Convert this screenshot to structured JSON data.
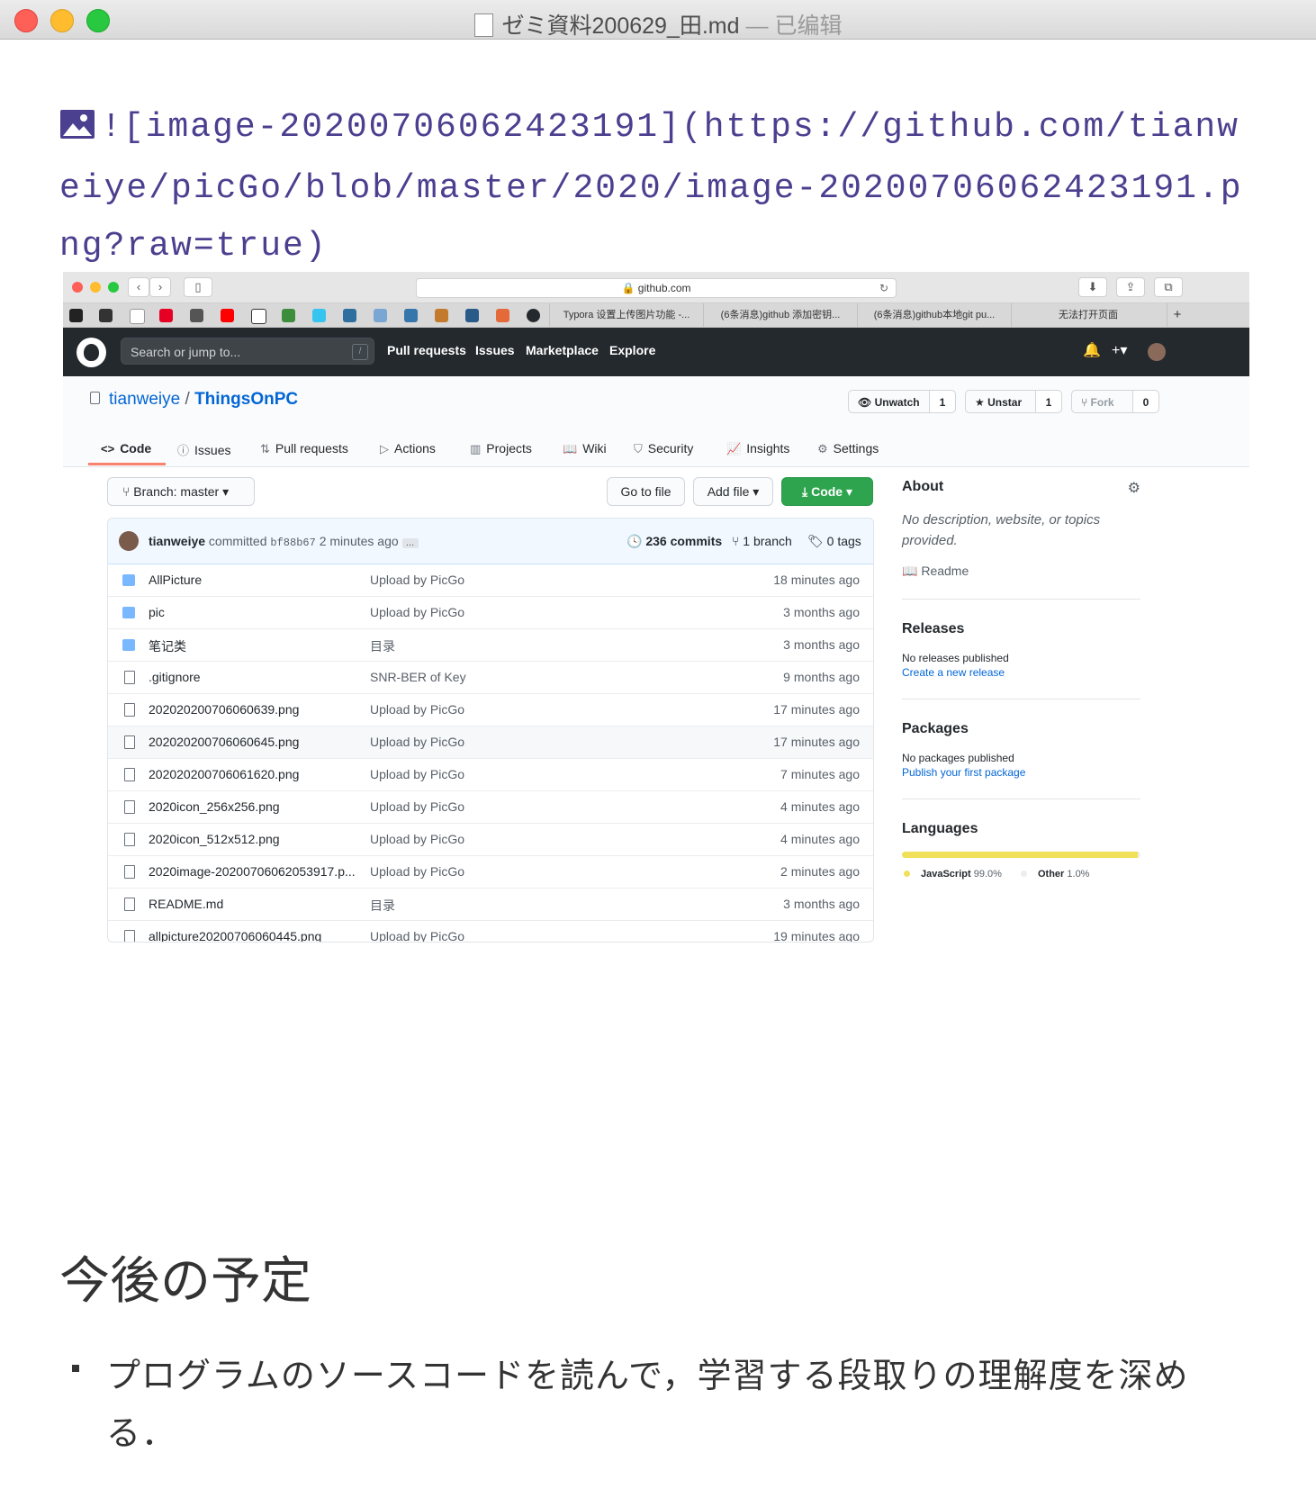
{
  "window": {
    "title": "ゼミ資料200629_田.md",
    "edited_suffix": " — 已编辑"
  },
  "markdown": {
    "image_source": "![image-20200706062423191](https://github.com/tianweiye/picGo/blob/master/2020/image-20200706062423191.png?raw=true)",
    "heading": "今後の予定",
    "bullet_1": "プログラムのソースコードを読んで，学習する段取りの理解度を深める．"
  },
  "browser": {
    "url": "github.com",
    "tabs": [
      "Typora 设置上传图片功能 -...",
      "(6条消息)github 添加密钥...",
      "(6条消息)github本地git pu...",
      "无法打开页面"
    ]
  },
  "github": {
    "search_placeholder": "Search or jump to...",
    "slash_hint": "/",
    "nav": [
      "Pull requests",
      "Issues",
      "Marketplace",
      "Explore"
    ],
    "repo_owner": "tianweiye",
    "repo_separator": " / ",
    "repo_name": "ThingsOnPC",
    "unwatch_label": "Unwatch",
    "unwatch_count": "1",
    "unstar_label": "Unstar",
    "unstar_count": "1",
    "fork_label": "Fork",
    "fork_count": "0",
    "tabs": [
      "Code",
      "Issues",
      "Pull requests",
      "Actions",
      "Projects",
      "Wiki",
      "Security",
      "Insights",
      "Settings"
    ],
    "branch_label": "Branch: master",
    "go_to_file": "Go to file",
    "add_file": "Add file",
    "code_button": "Code",
    "commit": {
      "author": "tianweiye",
      "action": "committed",
      "hash": "bf88b67",
      "time": "2 minutes ago",
      "ellipsis": "…",
      "commits": "236 commits",
      "branches": "1 branch",
      "tags": "0 tags"
    },
    "files": [
      {
        "name": "AllPicture",
        "msg": "Upload by PicGo",
        "age": "18 minutes ago"
      },
      {
        "name": "pic",
        "msg": "Upload by PicGo",
        "age": "3 months ago"
      },
      {
        "name": "笔记类",
        "msg": "目录",
        "age": "3 months ago"
      },
      {
        "name": ".gitignore",
        "msg": "SNR-BER of Key",
        "age": "9 months ago"
      },
      {
        "name": "202020200706060639.png",
        "msg": "Upload by PicGo",
        "age": "17 minutes ago"
      },
      {
        "name": "202020200706060645.png",
        "msg": "Upload by PicGo",
        "age": "17 minutes ago"
      },
      {
        "name": "202020200706061620.png",
        "msg": "Upload by PicGo",
        "age": "7 minutes ago"
      },
      {
        "name": "2020icon_256x256.png",
        "msg": "Upload by PicGo",
        "age": "4 minutes ago"
      },
      {
        "name": "2020icon_512x512.png",
        "msg": "Upload by PicGo",
        "age": "4 minutes ago"
      },
      {
        "name": "2020image-20200706062053917.p...",
        "msg": "Upload by PicGo",
        "age": "2 minutes ago"
      },
      {
        "name": "README.md",
        "msg": "目录",
        "age": "3 months ago"
      },
      {
        "name": "allpicture20200706060445.png",
        "msg": "Upload by PicGo",
        "age": "19 minutes ago"
      }
    ],
    "about": {
      "heading": "About",
      "description": "No description, website, or topics provided.",
      "readme": "Readme"
    },
    "releases": {
      "heading": "Releases",
      "text": "No releases published",
      "link": "Create a new release"
    },
    "packages": {
      "heading": "Packages",
      "text": "No packages published",
      "link": "Publish your first package"
    },
    "languages": {
      "heading": "Languages",
      "items": [
        {
          "name": "JavaScript",
          "percent": "99.0%",
          "color": "#f1e05a",
          "fraction": 0.99
        },
        {
          "name": "Other",
          "percent": "1.0%",
          "color": "#ededed",
          "fraction": 0.01
        }
      ]
    }
  },
  "colors": {
    "markdown_source": "#4b3f8f",
    "github_header": "#24292e",
    "link": "#0366d6",
    "code_button": "#2ea44f"
  }
}
